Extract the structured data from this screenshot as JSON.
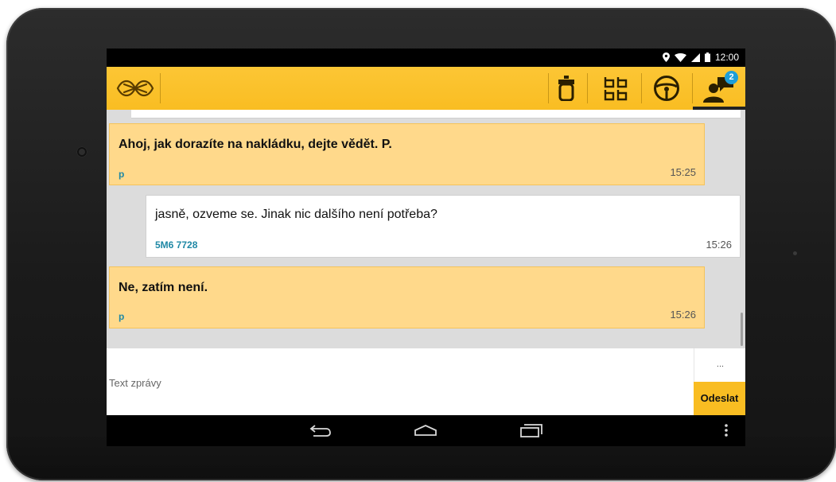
{
  "statusbar": {
    "time": "12:00",
    "icons": [
      "location-icon",
      "wifi-icon",
      "signal-icon",
      "battery-icon"
    ]
  },
  "actionbar": {
    "logo": "app-logo-icon",
    "tabs": [
      {
        "name": "vehicle-tab",
        "icon": "vehicle-icon"
      },
      {
        "name": "routes-tab",
        "icon": "route-grid-icon"
      },
      {
        "name": "driving-tab",
        "icon": "steering-wheel-icon"
      },
      {
        "name": "messages-tab",
        "icon": "chat-user-icon",
        "active": true,
        "badge": "2"
      }
    ],
    "accent_color": "#f9bd22",
    "badge_color": "#1e9ed8"
  },
  "messages": [
    {
      "direction": "in",
      "text": "Ahoj, jak dorazíte na nakládku, dejte vědět. P.",
      "sender": "p",
      "time": "15:25"
    },
    {
      "direction": "out",
      "text": "jasně, ozveme se. Jinak nic dalšího není potřeba?",
      "sender": "5M6 7728",
      "time": "15:26"
    },
    {
      "direction": "in",
      "text": "Ne, zatím není.",
      "sender": "p",
      "time": "15:26"
    }
  ],
  "composer": {
    "placeholder": "Text zprávy",
    "value": "",
    "more_label": "...",
    "send_label": "Odeslat"
  },
  "navbar": {
    "buttons": [
      "back-icon",
      "home-icon",
      "recents-icon",
      "overflow-menu-icon"
    ]
  }
}
